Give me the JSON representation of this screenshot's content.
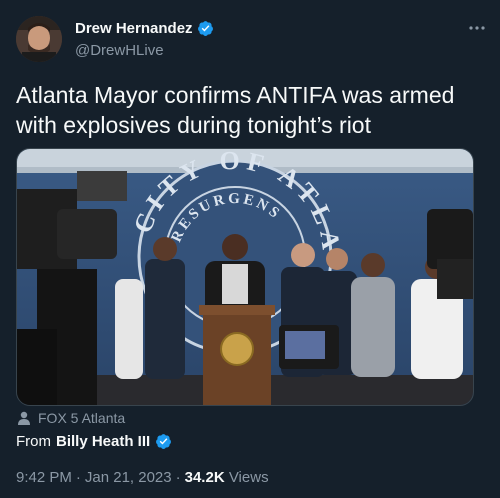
{
  "author": {
    "display_name": "Drew Hernandez",
    "handle": "@DrewHLive",
    "verified": true
  },
  "more_icon": "more-icon",
  "tweet": {
    "text": "Atlanta Mayor confirms ANTIFA was armed with explosives during tonight’s riot"
  },
  "media": {
    "seal_text_top": "CITY OF ATLANTA",
    "seal_text_inner": "RESURGENS"
  },
  "source": {
    "icon": "person-icon",
    "label": "FOX 5 Atlanta"
  },
  "from": {
    "prefix": "From",
    "name": "Billy Heath III",
    "verified": true
  },
  "meta": {
    "time": "9:42 PM",
    "separator": "·",
    "date": "Jan 21, 2023",
    "views_count": "34.2K",
    "views_label": "Views"
  },
  "colors": {
    "background": "#15202b",
    "verified_blue": "#1d9bf0",
    "secondary_text": "#8b98a5"
  }
}
